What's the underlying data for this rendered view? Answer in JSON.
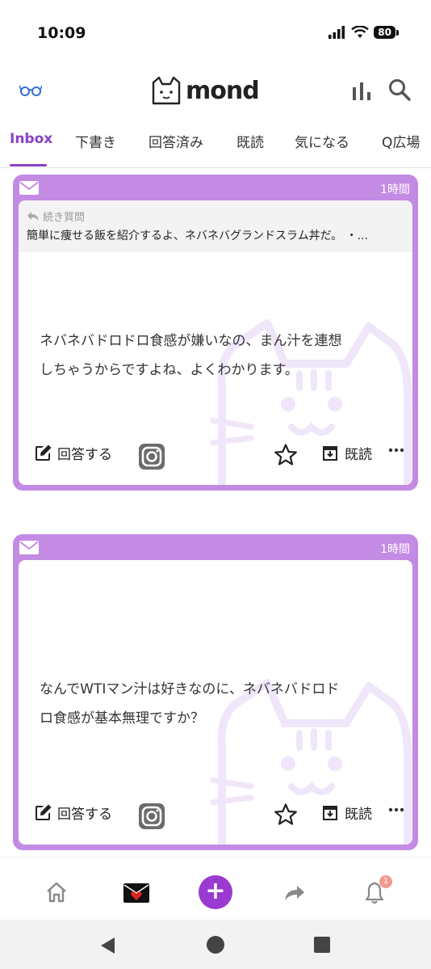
{
  "status": {
    "time": "10:09",
    "battery": "80"
  },
  "header": {
    "logo_text": "mond"
  },
  "tabs": [
    {
      "label": "Inbox",
      "active": true
    },
    {
      "label": "下書き"
    },
    {
      "label": "回答済み"
    },
    {
      "label": "既読"
    },
    {
      "label": "気になる"
    },
    {
      "label": "Q広場"
    }
  ],
  "cards": [
    {
      "time": "1時間",
      "followup_label": "続き質問",
      "followup_text": "簡単に痩せる飯を紹介するよ、ネバネバグランドスラム丼だ。 ・...",
      "question_line1": "ネバネバドロドロ食感が嫌いなの、まん汁を連想",
      "question_line2": "しちゃうからですよね、よくわかります。",
      "answer_label": "回答する",
      "read_label": "既読"
    },
    {
      "time": "1時間",
      "question_line1": "なんでWTIマン汁は好きなのに、ネバネバドロド",
      "question_line2": "ロ食感が基本無理ですか？",
      "answer_label": "回答する",
      "read_label": "既読"
    }
  ],
  "bottom_nav": {
    "plus": "+",
    "notification_count": "1"
  },
  "colors": {
    "accent": "#8b3fc8",
    "card": "#c38be3",
    "plus": "#9a3ad0"
  }
}
